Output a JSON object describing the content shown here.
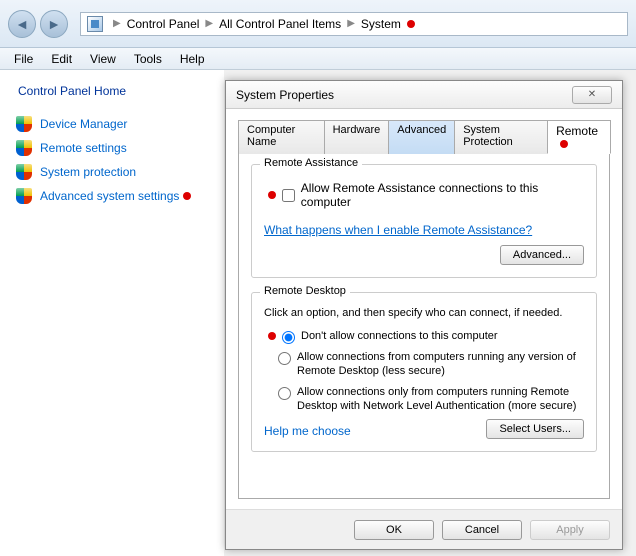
{
  "breadcrumb": [
    "Control Panel",
    "All Control Panel Items",
    "System"
  ],
  "menu": [
    "File",
    "Edit",
    "View",
    "Tools",
    "Help"
  ],
  "sidebar": {
    "heading": "Control Panel Home",
    "items": [
      {
        "label": "Device Manager"
      },
      {
        "label": "Remote settings"
      },
      {
        "label": "System protection"
      },
      {
        "label": "Advanced system settings",
        "marked": true
      }
    ]
  },
  "dialog": {
    "title": "System Properties",
    "tabs": [
      "Computer Name",
      "Hardware",
      "Advanced",
      "System Protection",
      "Remote"
    ],
    "active_tab": "Remote",
    "remote_assistance": {
      "group_title": "Remote Assistance",
      "checkbox_label": "Allow Remote Assistance connections to this computer",
      "checkbox_checked": false,
      "help_link": "What happens when I enable Remote Assistance?",
      "advanced_btn": "Advanced..."
    },
    "remote_desktop": {
      "group_title": "Remote Desktop",
      "desc": "Click an option, and then specify who can connect, if needed.",
      "options": [
        "Don't allow connections to this computer",
        "Allow connections from computers running any version of Remote Desktop (less secure)",
        "Allow connections only from computers running Remote Desktop with Network Level Authentication (more secure)"
      ],
      "selected": 0,
      "help_link": "Help me choose",
      "select_users_btn": "Select Users..."
    },
    "footer": {
      "ok": "OK",
      "cancel": "Cancel",
      "apply": "Apply"
    }
  }
}
